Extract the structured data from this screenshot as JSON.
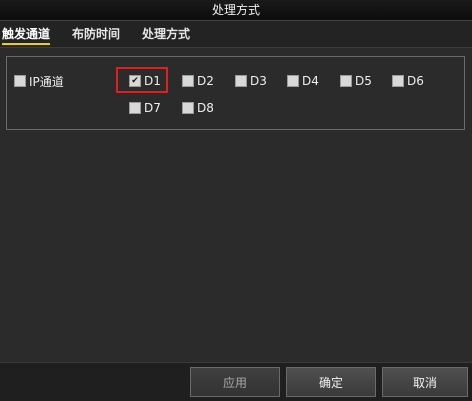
{
  "window": {
    "title": "处理方式"
  },
  "tabs": [
    {
      "label": "触发通道",
      "active": true
    },
    {
      "label": "布防时间",
      "active": false
    },
    {
      "label": "处理方式",
      "active": false
    }
  ],
  "channels": {
    "ip_channel": {
      "label": "IP通道",
      "checked": false
    },
    "items": [
      {
        "label": "D1",
        "checked": true
      },
      {
        "label": "D2",
        "checked": false
      },
      {
        "label": "D3",
        "checked": false
      },
      {
        "label": "D4",
        "checked": false
      },
      {
        "label": "D5",
        "checked": false
      },
      {
        "label": "D6",
        "checked": false
      },
      {
        "label": "D7",
        "checked": false
      },
      {
        "label": "D8",
        "checked": false
      }
    ]
  },
  "buttons": {
    "apply": "应用",
    "ok": "确定",
    "cancel": "取消"
  },
  "colors": {
    "accent": "#f0d000",
    "highlight": "#e02020"
  }
}
